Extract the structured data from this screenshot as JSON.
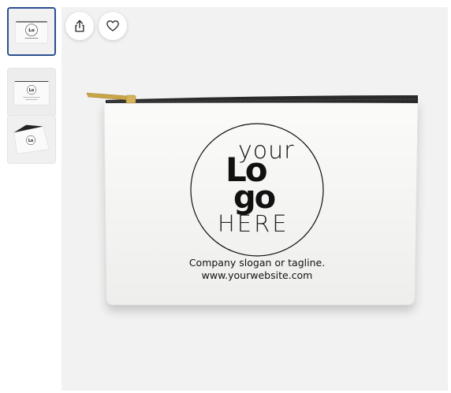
{
  "thumbnails": [
    {
      "label": "Front view",
      "selected": true
    },
    {
      "label": "Back view",
      "selected": false
    },
    {
      "label": "Open view",
      "selected": false
    }
  ],
  "actions": {
    "share_icon": "share-icon",
    "favorite_icon": "heart-icon"
  },
  "product": {
    "logo_line1": "your",
    "logo_line2": "Lo",
    "logo_line3": "go",
    "logo_line4": "HERE",
    "slogan": "Company slogan or tagline.",
    "website": "www.yourwebsite.com"
  },
  "colors": {
    "selected_border": "#2c4f8f",
    "background": "#f2f2f2",
    "pouch": "#f7f7f5",
    "zipper": "#2a2a2a",
    "zipper_pull": "#c9a54a"
  }
}
